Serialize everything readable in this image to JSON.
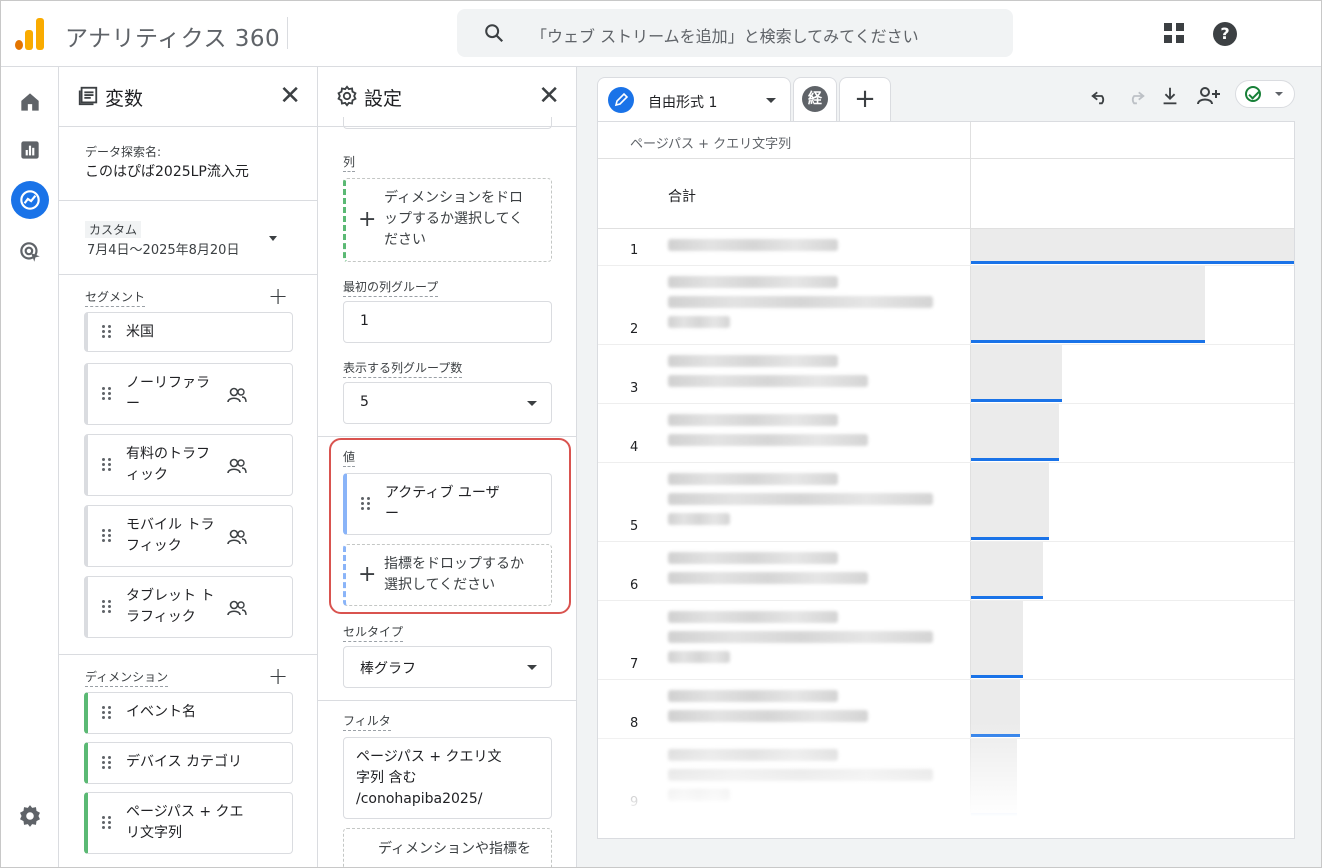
{
  "header": {
    "app_title": "アナリティクス 360",
    "search_placeholder": "「ウェブ ストリームを追加」と検索してみてください"
  },
  "nav": {
    "items": [
      "home-icon",
      "reports-icon",
      "explore-icon",
      "advertising-icon"
    ],
    "active": "explore-icon",
    "bottom": "settings-icon"
  },
  "variables": {
    "title": "変数",
    "exploration_label": "データ探索名:",
    "exploration_name": "このはぴば2025LP流入元",
    "date_badge": "カスタム",
    "date_range": "7月4日〜2025年8月20日",
    "segments_label": "セグメント",
    "segments": [
      {
        "line1": "米国",
        "line2": "",
        "user_icon": false
      },
      {
        "line1": "ノーリファラ",
        "line2": "ー",
        "user_icon": true
      },
      {
        "line1": "有料のトラフ",
        "line2": "ィック",
        "user_icon": true
      },
      {
        "line1": "モバイル トラ",
        "line2": "フィック",
        "user_icon": true
      },
      {
        "line1": "タブレット ト",
        "line2": "ラフィック",
        "user_icon": true
      }
    ],
    "dimensions_label": "ディメンション",
    "dimensions": [
      {
        "line1": "イベント名",
        "line2": ""
      },
      {
        "line1": "デバイス カテゴリ",
        "line2": ""
      },
      {
        "line1": "ページパス + クエ",
        "line2": "リ文字列"
      }
    ]
  },
  "settings": {
    "title": "設定",
    "columns_label": "列",
    "columns_drop": [
      "ディメンションをドロ",
      "ップするか選択してく",
      "ださい"
    ],
    "first_group_label": "最初の列グループ",
    "first_group_value": "1",
    "group_count_label": "表示する列グループ数",
    "group_count_value": "5",
    "values_label": "値",
    "value_chip": [
      "アクティブ ユーザ",
      "ー"
    ],
    "values_drop": [
      "指標をドロップするか",
      "選択してください"
    ],
    "cell_type_label": "セルタイプ",
    "cell_type_value": "棒グラフ",
    "filter_label": "フィルタ",
    "filter_value": [
      "ページパス + クエリ文",
      "字列 含む",
      "/conohapiba2025/"
    ],
    "filter_drop": "ディメンションや指標を"
  },
  "report": {
    "tab_name": "自由形式 1",
    "tab2_badge": "経",
    "column_header": "ページパス + クエリ文字列",
    "total_label": "合計",
    "rows": [
      {
        "rank": "1",
        "lines": 1,
        "share": 1.0
      },
      {
        "rank": "2",
        "lines": 3,
        "share": 0.72
      },
      {
        "rank": "3",
        "lines": 2,
        "share": 0.28
      },
      {
        "rank": "4",
        "lines": 2,
        "share": 0.27
      },
      {
        "rank": "5",
        "lines": 3,
        "share": 0.24
      },
      {
        "rank": "6",
        "lines": 2,
        "share": 0.22
      },
      {
        "rank": "7",
        "lines": 3,
        "share": 0.16
      },
      {
        "rank": "8",
        "lines": 2,
        "share": 0.15
      },
      {
        "rank": "9",
        "lines": 3,
        "share": 0.14
      }
    ],
    "toolbar": [
      "undo-icon",
      "redo-icon",
      "download-icon",
      "share-user-icon",
      "status-check-icon"
    ]
  },
  "colors": {
    "accent": "#1a73e8",
    "dimension_green": "#5bb974",
    "highlight_red": "#d9534f"
  }
}
